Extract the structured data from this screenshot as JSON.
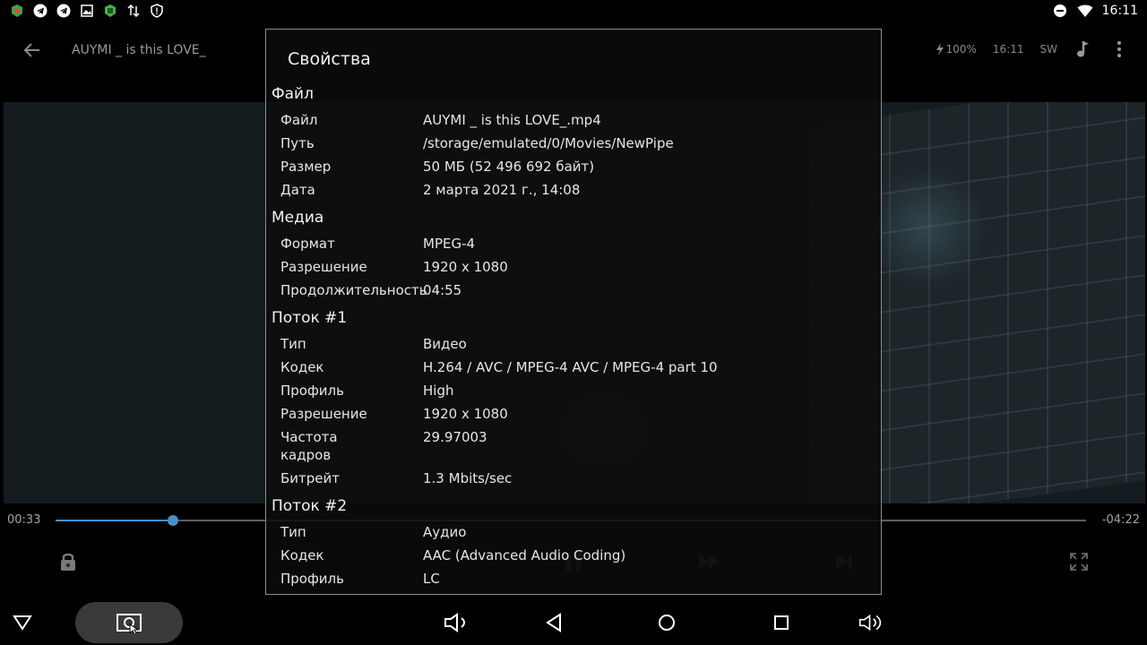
{
  "status_bar": {
    "time": "16:11",
    "left_icons": [
      "app-icon",
      "telegram-icon",
      "telegram-icon",
      "image-icon",
      "game-icon",
      "data-transfer-icon",
      "shield-icon"
    ],
    "right_icons": [
      "do-not-disturb-icon",
      "wifi-icon"
    ]
  },
  "player": {
    "title": "AUYMI _ is this LOVE_",
    "battery": "100%",
    "clock": "16:11",
    "decoder": "SW",
    "current_time": "00:33",
    "remaining_time": "-04:22",
    "progress_fraction": 0.114
  },
  "dialog": {
    "title": "Свойства",
    "sections": [
      {
        "header": "Файл",
        "rows": [
          {
            "key": "Файл",
            "value": "AUYMI _ is this LOVE_.mp4"
          },
          {
            "key": "Путь",
            "value": "/storage/emulated/0/Movies/NewPipe"
          },
          {
            "key": "Размер",
            "value": "50 МБ (52 496 692 байт)"
          },
          {
            "key": "Дата",
            "value": "2 марта 2021 г., 14:08"
          }
        ]
      },
      {
        "header": "Медиа",
        "rows": [
          {
            "key": "Формат",
            "value": "MPEG-4"
          },
          {
            "key": "Разрешение",
            "value": "1920 x 1080"
          },
          {
            "key": "Продолжительность",
            "value": "04:55"
          }
        ]
      },
      {
        "header": "Поток #1",
        "rows": [
          {
            "key": "Тип",
            "value": "Видео"
          },
          {
            "key": "Кодек",
            "value": "H.264 / AVC / MPEG-4 AVC / MPEG-4 part 10"
          },
          {
            "key": "Профиль",
            "value": "High"
          },
          {
            "key": "Разрешение",
            "value": "1920 x 1080"
          },
          {
            "key": "Частота кадров",
            "value": "29.97003"
          },
          {
            "key": "Битрейт",
            "value": "1.3 Mbits/sec"
          }
        ]
      },
      {
        "header": "Поток #2",
        "rows": [
          {
            "key": "Тип",
            "value": "Аудио"
          },
          {
            "key": "Кодек",
            "value": "AAC (Advanced Audio Coding)"
          },
          {
            "key": "Профиль",
            "value": "LC"
          }
        ]
      }
    ]
  },
  "colors": {
    "accent": "#4a8fc7",
    "dialog_border": "#8c8c8c",
    "dialog_bg": "#0c0c0c"
  }
}
